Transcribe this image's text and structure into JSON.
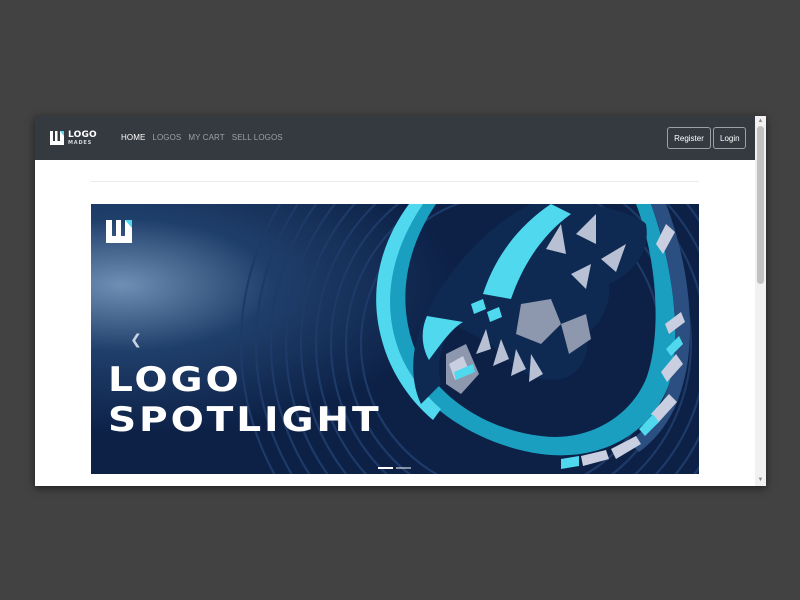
{
  "brand": {
    "line1": "LOGO",
    "line2": "MADES",
    "icon": "logo-mark-icon"
  },
  "nav": {
    "items": [
      {
        "label": "HOME",
        "active": true
      },
      {
        "label": "LOGOS",
        "active": false
      },
      {
        "label": "MY CART",
        "active": false
      },
      {
        "label": "SELL LOGOS",
        "active": false
      }
    ]
  },
  "auth": {
    "register_label": "Register",
    "login_label": "Login"
  },
  "carousel": {
    "headline_line1": "LOGO",
    "headline_line2": "SPOTLIGHT",
    "prev_icon": "chevron-left-icon",
    "slide_count": 2,
    "active_slide": 1
  },
  "colors": {
    "navbar_bg": "#343a40",
    "banner_bg": "#0d2147",
    "accent_cyan": "#4fd8ee",
    "page_bg": "#424242"
  }
}
